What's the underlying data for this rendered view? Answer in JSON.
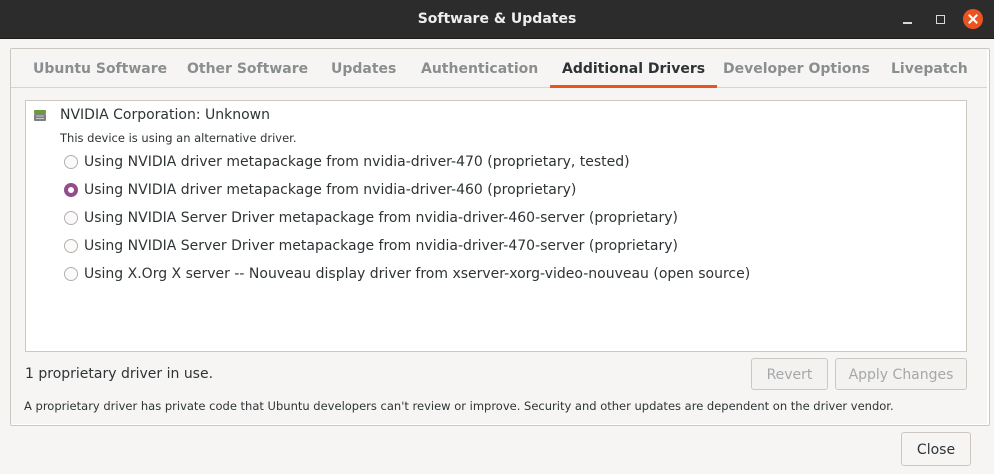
{
  "window": {
    "title": "Software & Updates"
  },
  "tabs": [
    {
      "label": "Ubuntu Software",
      "active": false
    },
    {
      "label": "Other Software",
      "active": false
    },
    {
      "label": "Updates",
      "active": false
    },
    {
      "label": "Authentication",
      "active": false
    },
    {
      "label": "Additional Drivers",
      "active": true
    },
    {
      "label": "Developer Options",
      "active": false
    },
    {
      "label": "Livepatch",
      "active": false
    }
  ],
  "device": {
    "icon": "chip-icon",
    "name": "NVIDIA Corporation: Unknown",
    "note": "This device is using an alternative driver.",
    "options": [
      {
        "label": "Using NVIDIA driver metapackage from nvidia-driver-470 (proprietary, tested)",
        "selected": false
      },
      {
        "label": "Using NVIDIA driver metapackage from nvidia-driver-460 (proprietary)",
        "selected": true
      },
      {
        "label": "Using NVIDIA Server Driver metapackage from nvidia-driver-460-server (proprietary)",
        "selected": false
      },
      {
        "label": "Using NVIDIA Server Driver metapackage from nvidia-driver-470-server (proprietary)",
        "selected": false
      },
      {
        "label": "Using X.Org X server -- Nouveau display driver from xserver-xorg-video-nouveau (open source)",
        "selected": false
      }
    ]
  },
  "status": {
    "text": "1 proprietary driver in use."
  },
  "buttons": {
    "revert": "Revert",
    "apply": "Apply Changes",
    "close": "Close"
  },
  "footer": {
    "note": "A proprietary driver has private code that Ubuntu developers can't review or improve. Security and other updates are dependent on the driver vendor."
  },
  "colors": {
    "accent": "#e95420",
    "radio_checked": "#924d8b",
    "titlebar": "#2c2c2c"
  }
}
